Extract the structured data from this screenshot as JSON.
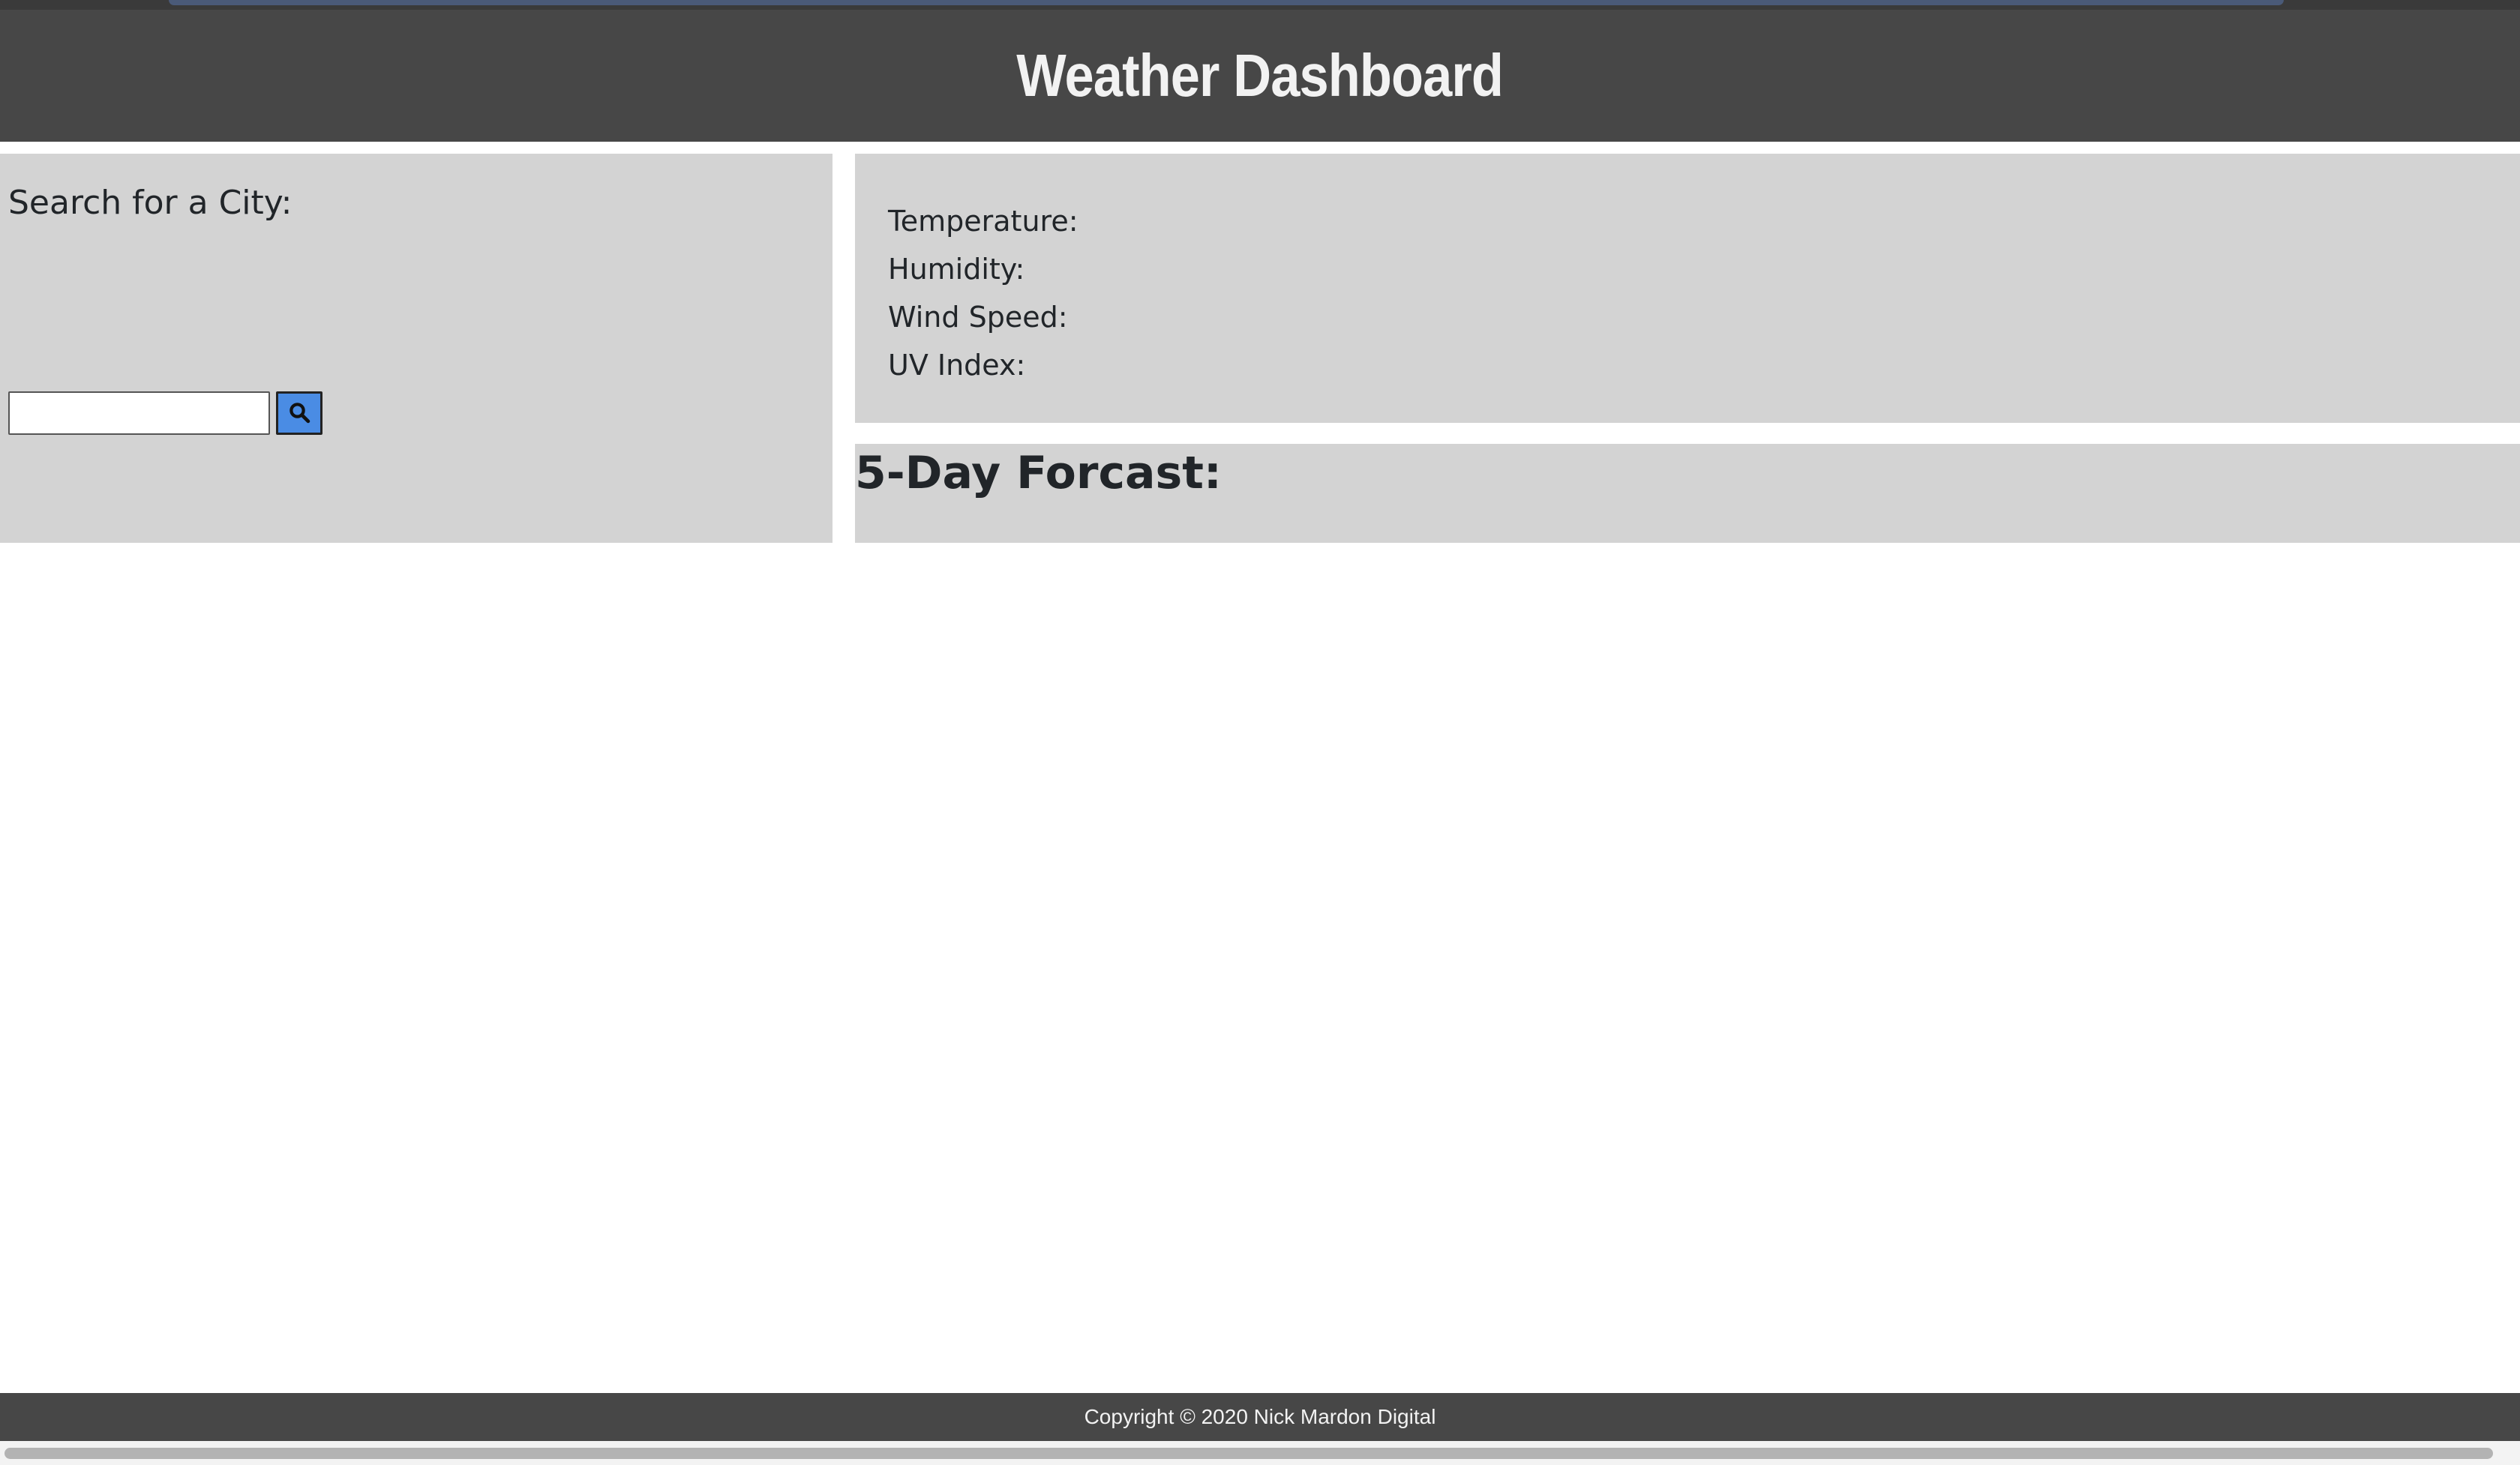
{
  "header": {
    "title": "Weather Dashboard"
  },
  "search": {
    "label": "Search for a City:",
    "input_value": "",
    "input_placeholder": "",
    "button_icon": "search-icon"
  },
  "current_weather": {
    "fields": [
      {
        "label": "Temperature:"
      },
      {
        "label": "Humidity:"
      },
      {
        "label": "Wind Speed:"
      },
      {
        "label": "UV Index:"
      }
    ]
  },
  "forecast": {
    "title": "5-Day Forcast:"
  },
  "footer": {
    "text": "Copyright © 2020 Nick Mardon Digital"
  },
  "colors": {
    "header_bg": "#474747",
    "panel_bg": "#d3d3d3",
    "button_bg": "#4a8ce4",
    "header_text": "#f2f2f2"
  }
}
